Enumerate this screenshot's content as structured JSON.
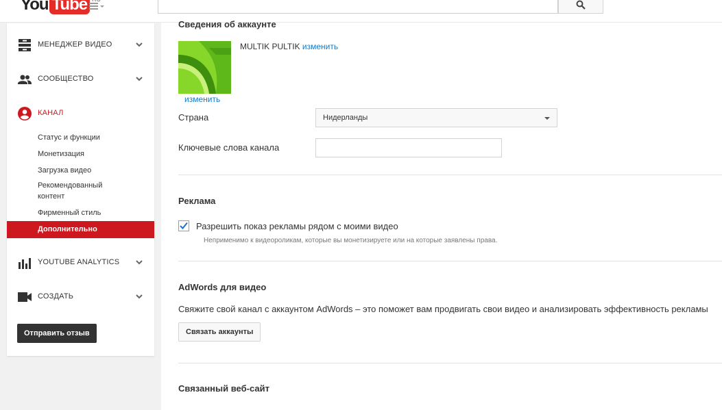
{
  "header": {
    "logo_you": "You",
    "logo_tube": "Tube",
    "logo_region": "RU",
    "search_placeholder": ""
  },
  "sidebar": {
    "sections": [
      {
        "label": "МЕНЕДЖЕР ВИДЕО",
        "icon": "video-manager-icon"
      },
      {
        "label": "СООБЩЕСТВО",
        "icon": "community-icon"
      },
      {
        "label": "КАНАЛ",
        "icon": "channel-icon"
      },
      {
        "label": "YOUTUBE ANALYTICS",
        "icon": "analytics-icon"
      },
      {
        "label": "СОЗДАТЬ",
        "icon": "create-icon"
      }
    ],
    "channel_items": [
      "Статус и функции",
      "Монетизация",
      "Загрузка видео",
      "Рекомендованный контент",
      "Фирменный стиль",
      "Дополнительно"
    ],
    "feedback_label": "Отправить отзыв"
  },
  "account": {
    "section_title": "Сведения об аккаунте",
    "channel_name": "MULTIK PULTIK",
    "edit_name_link": "изменить",
    "edit_avatar_link": "изменить",
    "country_label": "Страна",
    "country_value": "Нидерланды",
    "keywords_label": "Ключевые слова канала",
    "keywords_value": ""
  },
  "ads": {
    "title": "Реклама",
    "checkbox_label": "Разрешить показ рекламы рядом с моими видео",
    "checkbox_checked": true,
    "note": "Неприменимо к видеороликам, которые вы монетизируете или на которые заявлены права."
  },
  "adwords": {
    "title": "AdWords для видео",
    "description": "Свяжите свой канал с аккаунтом AdWords – это поможет вам продвигать свои видео и анализировать эффективность рекламы",
    "link_button": "Связать аккаунты"
  },
  "website": {
    "title": "Связанный веб-сайт"
  },
  "colors": {
    "accent_red": "#cc181e",
    "link_blue": "#167ac6",
    "avatar_green": "#7fd321"
  }
}
